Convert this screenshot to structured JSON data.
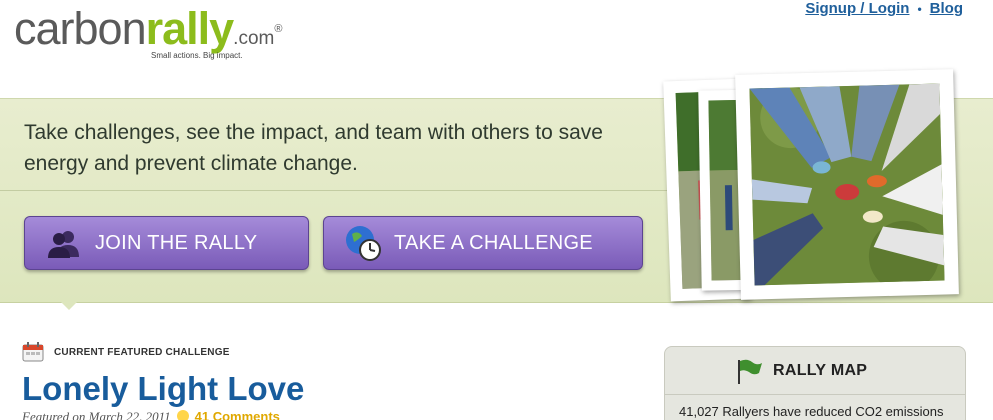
{
  "header": {
    "logo": {
      "carbon": "carbon",
      "rally": "rally",
      "dotcom": ".com",
      "reg": "®",
      "tagline": "Small actions. Big impact."
    },
    "links": {
      "signup_login": "Signup / Login",
      "separator": "•",
      "blog": "Blog"
    }
  },
  "hero": {
    "text": "Take challenges, see the impact, and team with others to save energy and prevent climate change.",
    "buttons": {
      "join": "JOIN THE RALLY",
      "challenge": "TAKE A CHALLENGE"
    }
  },
  "featured": {
    "label": "CURRENT FEATURED CHALLENGE",
    "title": "Lonely Light Love",
    "meta": "Featured on March 22, 2011",
    "comments": "41 Comments"
  },
  "rally_map": {
    "title": "RALLY MAP",
    "stat": "41,027 Rallyers have reduced CO2 emissions"
  },
  "colors": {
    "brand_green": "#8cbc1c",
    "link_blue": "#1f5f9b",
    "button_purple": "#7a5bb8",
    "hero_bg": "#e8edcf"
  },
  "icons": [
    "people-icon",
    "globe-clock-icon",
    "calendar-icon",
    "flag-icon",
    "comment-bubble-icon"
  ]
}
